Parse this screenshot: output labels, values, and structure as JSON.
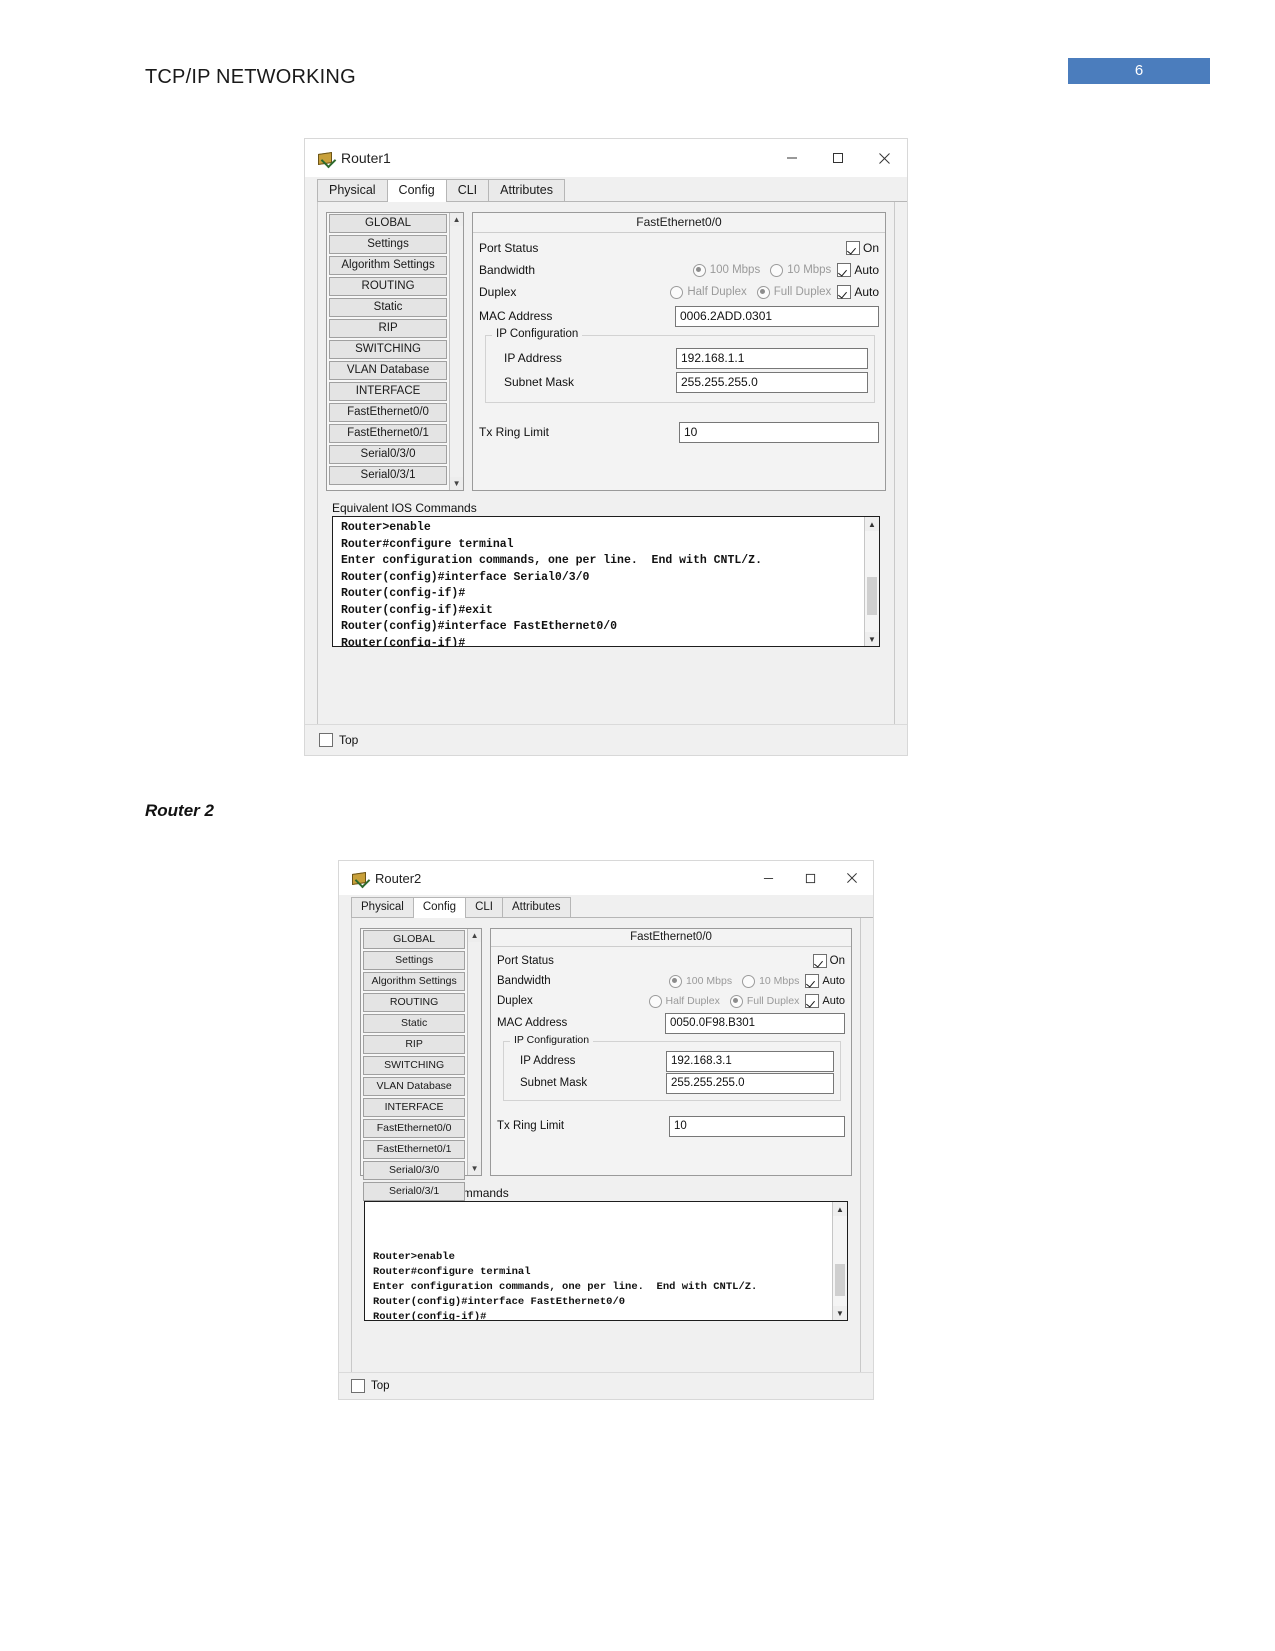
{
  "document": {
    "header_title": "TCP/IP NETWORKING",
    "page_number": "6",
    "page_badge_color": "#4b7dbd",
    "section_label": "Router 2"
  },
  "windows": [
    {
      "title": "Router1",
      "icon": "router-icon",
      "window_controls": {
        "minimize": "minimize-icon",
        "maximize": "maximize-icon",
        "close": "close-icon"
      },
      "tabs": [
        {
          "label": "Physical",
          "active": false
        },
        {
          "label": "Config",
          "active": true
        },
        {
          "label": "CLI",
          "active": false
        },
        {
          "label": "Attributes",
          "active": false
        }
      ],
      "sidebar": {
        "items": [
          "GLOBAL",
          "Settings",
          "Algorithm Settings",
          "ROUTING",
          "Static",
          "RIP",
          "SWITCHING",
          "VLAN Database",
          "INTERFACE",
          "FastEthernet0/0",
          "FastEthernet0/1",
          "Serial0/3/0",
          "Serial0/3/1"
        ],
        "scroll_up": "chevron-up-icon",
        "scroll_down": "chevron-down-icon"
      },
      "interface": {
        "title": "FastEthernet0/0",
        "port_status": {
          "label": "Port Status",
          "checkbox_label": "On",
          "checked": true
        },
        "bandwidth": {
          "label": "Bandwidth",
          "options": [
            {
              "label": "100 Mbps",
              "selected": true
            },
            {
              "label": "10 Mbps",
              "selected": false
            }
          ],
          "auto_label": "Auto",
          "auto_checked": true
        },
        "duplex": {
          "label": "Duplex",
          "options": [
            {
              "label": "Half Duplex",
              "selected": false
            },
            {
              "label": "Full Duplex",
              "selected": true
            }
          ],
          "auto_label": "Auto",
          "auto_checked": true
        },
        "mac_address": {
          "label": "MAC Address",
          "value": "0006.2ADD.0301"
        },
        "ip_configuration": {
          "legend": "IP Configuration",
          "ip_address": {
            "label": "IP Address",
            "value": "192.168.1.1"
          },
          "subnet_mask": {
            "label": "Subnet Mask",
            "value": "255.255.255.0"
          }
        },
        "tx_ring_limit": {
          "label": "Tx Ring Limit",
          "value": "10"
        }
      },
      "ios": {
        "label": "Equivalent IOS Commands",
        "text": "Router>enable\nRouter#configure terminal\nEnter configuration commands, one per line.  End with CNTL/Z.\nRouter(config)#interface Serial0/3/0\nRouter(config-if)#\nRouter(config-if)#exit\nRouter(config)#interface FastEthernet0/0\nRouter(config-if)#"
      },
      "footer": {
        "checkbox_label": "Top",
        "checked": false
      }
    },
    {
      "title": "Router2",
      "icon": "router-icon",
      "window_controls": {
        "minimize": "minimize-icon",
        "maximize": "maximize-icon",
        "close": "close-icon"
      },
      "tabs": [
        {
          "label": "Physical",
          "active": false
        },
        {
          "label": "Config",
          "active": true
        },
        {
          "label": "CLI",
          "active": false
        },
        {
          "label": "Attributes",
          "active": false
        }
      ],
      "sidebar": {
        "items": [
          "GLOBAL",
          "Settings",
          "Algorithm Settings",
          "ROUTING",
          "Static",
          "RIP",
          "SWITCHING",
          "VLAN Database",
          "INTERFACE",
          "FastEthernet0/0",
          "FastEthernet0/1",
          "Serial0/3/0",
          "Serial0/3/1"
        ],
        "scroll_up": "chevron-up-icon",
        "scroll_down": "chevron-down-icon"
      },
      "interface": {
        "title": "FastEthernet0/0",
        "port_status": {
          "label": "Port Status",
          "checkbox_label": "On",
          "checked": true
        },
        "bandwidth": {
          "label": "Bandwidth",
          "options": [
            {
              "label": "100 Mbps",
              "selected": true
            },
            {
              "label": "10 Mbps",
              "selected": false
            }
          ],
          "auto_label": "Auto",
          "auto_checked": true
        },
        "duplex": {
          "label": "Duplex",
          "options": [
            {
              "label": "Half Duplex",
              "selected": false
            },
            {
              "label": "Full Duplex",
              "selected": true
            }
          ],
          "auto_label": "Auto",
          "auto_checked": true
        },
        "mac_address": {
          "label": "MAC Address",
          "value": "0050.0F98.B301"
        },
        "ip_configuration": {
          "legend": "IP Configuration",
          "ip_address": {
            "label": "IP Address",
            "value": "192.168.3.1"
          },
          "subnet_mask": {
            "label": "Subnet Mask",
            "value": "255.255.255.0"
          }
        },
        "tx_ring_limit": {
          "label": "Tx Ring Limit",
          "value": "10"
        }
      },
      "ios": {
        "label": "Equivalent IOS Commands",
        "text": "\n\n\nRouter>enable\nRouter#configure terminal\nEnter configuration commands, one per line.  End with CNTL/Z.\nRouter(config)#interface FastEthernet0/0\nRouter(config-if)#"
      },
      "footer": {
        "checkbox_label": "Top",
        "checked": false
      }
    }
  ]
}
